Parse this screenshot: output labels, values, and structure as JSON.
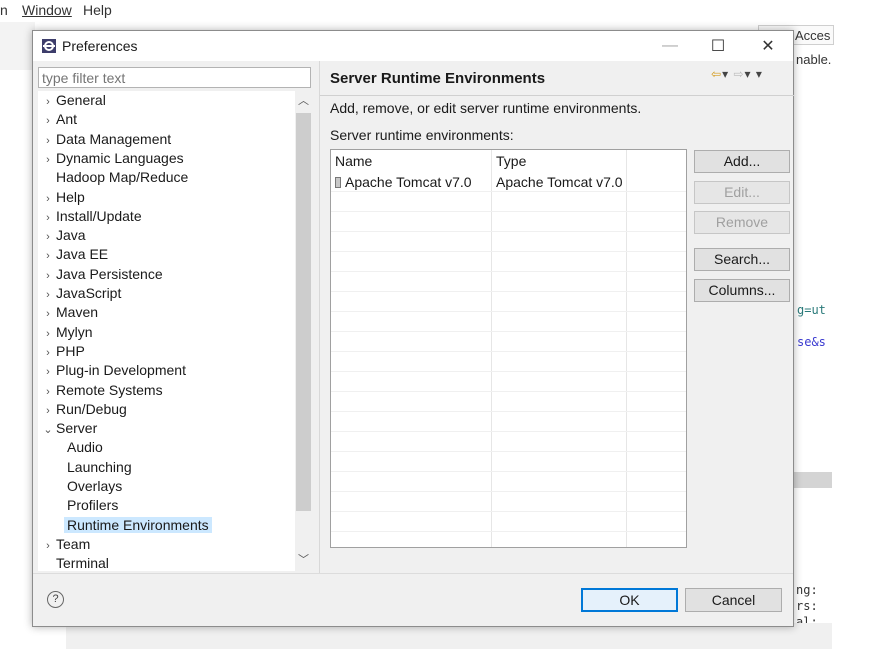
{
  "background": {
    "menus": [
      "n",
      "Window",
      "Help"
    ],
    "access_text": "Acces",
    "nable_text": "nable.",
    "code_lines": [
      "g=ut",
      "se&s",
      "ng:",
      "rs:",
      "al:"
    ]
  },
  "dialog": {
    "title": "Preferences",
    "window_controls": {
      "minimize": "—",
      "maximize": "☐",
      "close": "✕"
    }
  },
  "filter": {
    "placeholder": "type filter text"
  },
  "tree": {
    "items": [
      {
        "label": "General",
        "arrow": "›"
      },
      {
        "label": "Ant",
        "arrow": "›"
      },
      {
        "label": "Data Management",
        "arrow": "›"
      },
      {
        "label": "Dynamic Languages",
        "arrow": "›"
      },
      {
        "label": "Hadoop Map/Reduce",
        "arrow": ""
      },
      {
        "label": "Help",
        "arrow": "›"
      },
      {
        "label": "Install/Update",
        "arrow": "›"
      },
      {
        "label": "Java",
        "arrow": "›"
      },
      {
        "label": "Java EE",
        "arrow": "›"
      },
      {
        "label": "Java Persistence",
        "arrow": "›"
      },
      {
        "label": "JavaScript",
        "arrow": "›"
      },
      {
        "label": "Maven",
        "arrow": "›"
      },
      {
        "label": "Mylyn",
        "arrow": "›"
      },
      {
        "label": "PHP",
        "arrow": "›"
      },
      {
        "label": "Plug-in Development",
        "arrow": "›"
      },
      {
        "label": "Remote Systems",
        "arrow": "›"
      },
      {
        "label": "Run/Debug",
        "arrow": "›"
      },
      {
        "label": "Server",
        "arrow": "⌄"
      },
      {
        "label": "Audio",
        "child": true
      },
      {
        "label": "Launching",
        "child": true
      },
      {
        "label": "Overlays",
        "child": true
      },
      {
        "label": "Profilers",
        "child": true
      },
      {
        "label": "Runtime Environments",
        "child": true,
        "selected": true
      },
      {
        "label": "Team",
        "arrow": "›"
      },
      {
        "label": "Terminal",
        "arrow": ""
      }
    ]
  },
  "page": {
    "title": "Server Runtime Environments",
    "description": "Add, remove, or edit server runtime environments.",
    "list_label": "Server runtime environments:",
    "table": {
      "columns": [
        "Name",
        "Type"
      ],
      "rows": [
        {
          "name": "Apache Tomcat v7.0",
          "type": "Apache Tomcat v7.0"
        }
      ]
    },
    "buttons": {
      "add": "Add...",
      "edit": "Edit...",
      "remove": "Remove",
      "search": "Search...",
      "columns": "Columns..."
    }
  },
  "footer": {
    "help": "?",
    "ok": "OK",
    "cancel": "Cancel"
  },
  "colors": {
    "selection": "#cce8ff",
    "default_button_border": "#0078d7"
  }
}
